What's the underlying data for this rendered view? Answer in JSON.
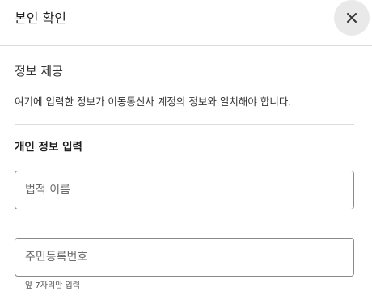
{
  "header": {
    "title": "본인 확인",
    "close_icon": "close-icon"
  },
  "section": {
    "title": "정보 제공",
    "description": "여기에 입력한 정보가 이동통신사 계정의 정보와 일치해야 합니다."
  },
  "personal_info": {
    "label": "개인 정보 입력",
    "name_field": {
      "placeholder": "법적 이름",
      "value": ""
    },
    "rrn_field": {
      "placeholder": "주민등록번호",
      "value": "",
      "helper": "앞 7자리만 입력"
    }
  }
}
